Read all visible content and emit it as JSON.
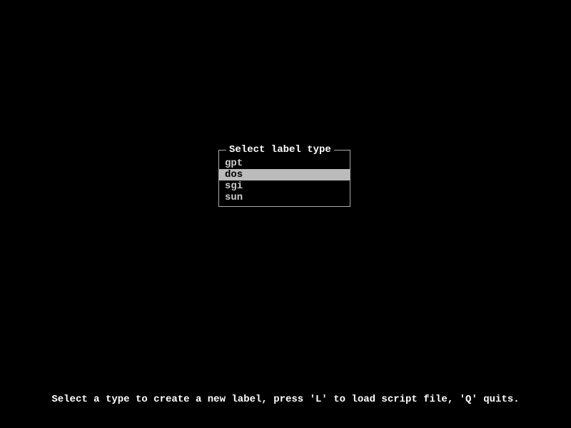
{
  "dialog": {
    "title": "Select label type",
    "options": [
      {
        "label": "gpt",
        "selected": false
      },
      {
        "label": "dos",
        "selected": true
      },
      {
        "label": "sgi",
        "selected": false
      },
      {
        "label": "sun",
        "selected": false
      }
    ]
  },
  "status": "Select a type to create a new label, press 'L' to load script file, 'Q' quits."
}
